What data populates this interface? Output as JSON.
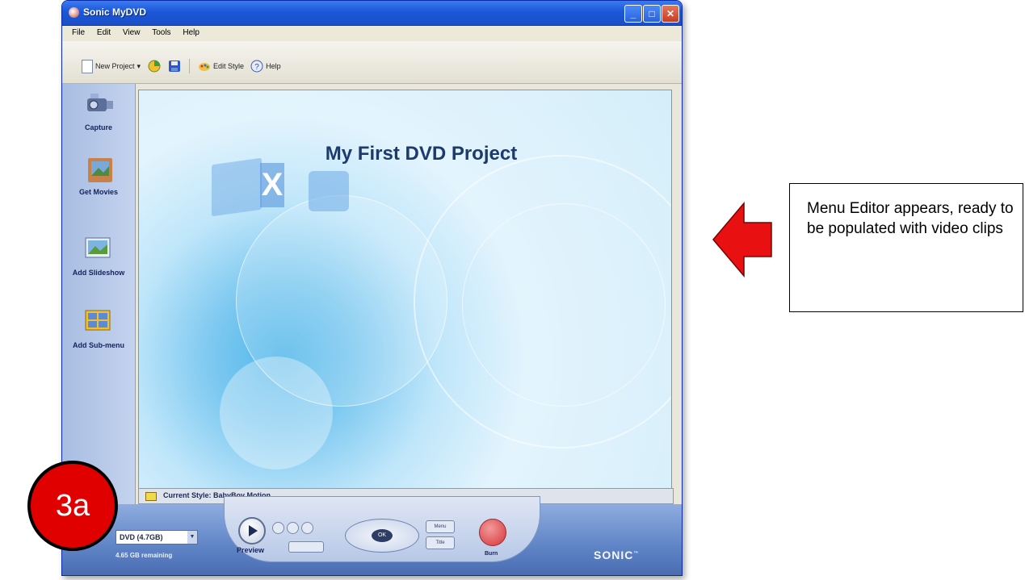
{
  "window": {
    "title": "Sonic MyDVD",
    "controls": {
      "minimize": "_",
      "maximize": "□",
      "close": "✕"
    }
  },
  "menu": [
    "File",
    "Edit",
    "View",
    "Tools",
    "Help"
  ],
  "toolbar": {
    "new_project": "New Project",
    "new_project_dropdown": "▾",
    "edit_style": "Edit Style",
    "help": "Help"
  },
  "sidebar": {
    "items": [
      {
        "label": "Capture",
        "icon": "camcorder-icon"
      },
      {
        "label": "Get Movies",
        "icon": "movie-frame-icon"
      },
      {
        "label": "Add Slideshow",
        "icon": "landscape-photo-icon"
      },
      {
        "label": "Add Sub-menu",
        "icon": "sub-menu-icon"
      }
    ]
  },
  "stage": {
    "project_title": "My First DVD Project",
    "glyph": "X"
  },
  "status": {
    "current_style": "Current Style: BabyBoy Motion"
  },
  "bottom": {
    "disc_type": "DVD (4.7GB)",
    "remaining": "4.65 GB remaining",
    "preview_label": "Preview",
    "dpad_center": "OK",
    "menu_btn": "Menu",
    "title_btn": "Title",
    "burn_label": "Burn",
    "brand": "SONIC",
    "brand_mark": "™"
  },
  "annotation": {
    "badge": "3a",
    "callout_text": "Menu Editor appears, ready to be populated with video clips"
  },
  "colors": {
    "accent_blue": "#1b57d8",
    "badge_red": "#e00000",
    "arrow_red": "#e81010"
  }
}
